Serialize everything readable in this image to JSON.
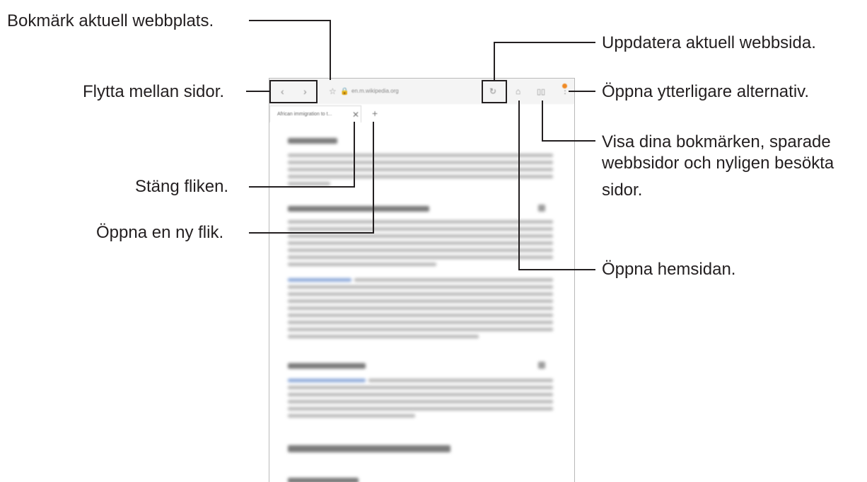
{
  "callouts": {
    "bookmark": "Bokmärk aktuell webbplats.",
    "navigate": "Flytta mellan sidor.",
    "close_tab": "Stäng fliken.",
    "new_tab": "Öppna en ny flik.",
    "refresh": "Uppdatera aktuell webbsida.",
    "more_options": "Öppna ytterligare alternativ.",
    "bookmarks_line1": "Visa dina bokmärken, sparade",
    "bookmarks_line2": "webbsidor och nyligen besökta",
    "bookmarks_line3": "sidor.",
    "home": "Öppna hemsidan."
  },
  "browser": {
    "url": "en.m.wikipedia.org",
    "tab_title": "African immigration to t..."
  },
  "icons": {
    "back": "chevron-left-icon",
    "forward": "chevron-right-icon",
    "star": "star-icon",
    "lock": "lock-icon",
    "refresh": "refresh-icon",
    "home": "home-icon",
    "bookmarks": "book-icon",
    "more": "more-vert-icon",
    "close": "close-icon",
    "add": "plus-icon"
  },
  "colors": {
    "text": "#231f20",
    "badge": "#f08a24",
    "link": "#3366cc"
  }
}
